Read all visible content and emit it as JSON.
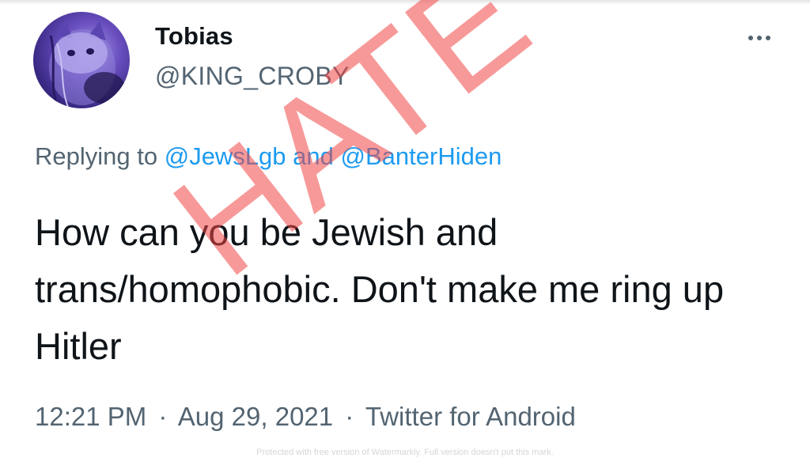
{
  "user": {
    "display_name": "Tobias",
    "handle": "@KING_CROBY",
    "avatar_icon": "cat-avatar-icon"
  },
  "menu": {
    "icon": "more-horizontal-icon"
  },
  "reply": {
    "prefix": "Replying to",
    "mention_1": "@JewsLgb",
    "joiner": "and",
    "mention_2": "@BanterHiden"
  },
  "tweet": {
    "text": "How can you be Jewish and trans/homophobic. Don't make me ring up Hitler"
  },
  "meta": {
    "time": "12:21 PM",
    "separator": "·",
    "date": "Aug 29, 2021",
    "source": "Twitter for Android"
  },
  "stamp": {
    "text": "HATE",
    "color": "#f04646"
  },
  "watermark": {
    "text": "Protected with free version of Watermarkly. Full version doesn't put this mark."
  },
  "colors": {
    "text_primary": "#0f1419",
    "text_secondary": "#536471",
    "link": "#1d9bf0"
  }
}
